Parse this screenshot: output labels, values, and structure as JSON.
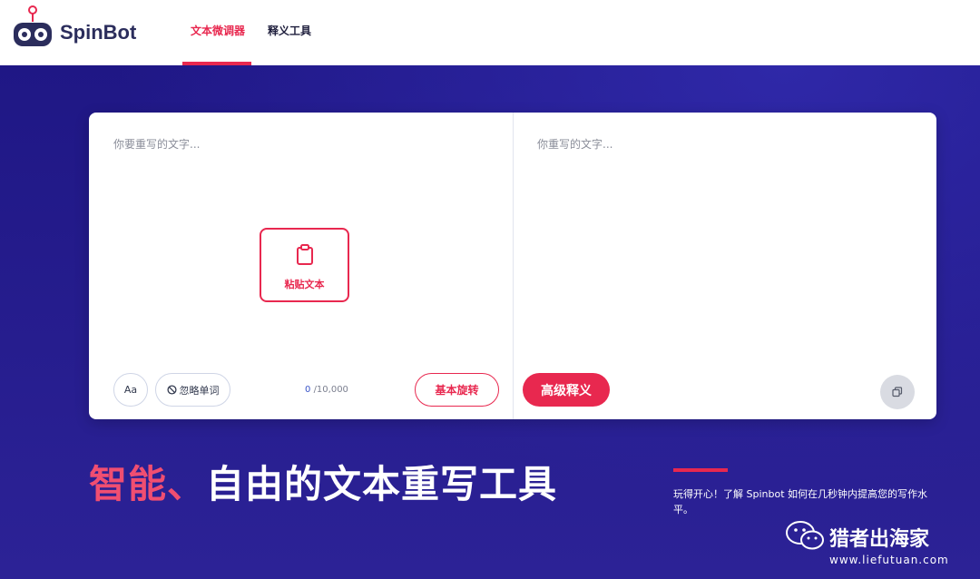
{
  "header": {
    "logo_text": "SpinBot",
    "nav": [
      {
        "label": "文本微调器",
        "active": true
      },
      {
        "label": "释义工具",
        "active": false
      }
    ]
  },
  "editor": {
    "input_placeholder": "你要重写的文字...",
    "output_placeholder": "你重写的文字...",
    "paste_label": "粘贴文本",
    "case_label": "Aa",
    "ignore_label": "忽略单词",
    "counter_current": "0",
    "counter_max": "/10,000",
    "basic_spin_label": "基本旋转",
    "advanced_label": "高级释义"
  },
  "hero": {
    "headline_accent": "智能、",
    "headline_rest": "自由的文本重写工具",
    "blurb": "玩得开心！了解 Spinbot 如何在几秒钟内提高您的写作水平。"
  },
  "watermark": {
    "title": "猎者出海家",
    "url": "www.liefutuan.com"
  },
  "colors": {
    "accent": "#e8284f",
    "hero_bg": "#2a1f8f"
  },
  "icons": [
    "spinbot-logo-icon",
    "clipboard-icon",
    "ban-icon",
    "copy-icon",
    "wechat-icon"
  ]
}
